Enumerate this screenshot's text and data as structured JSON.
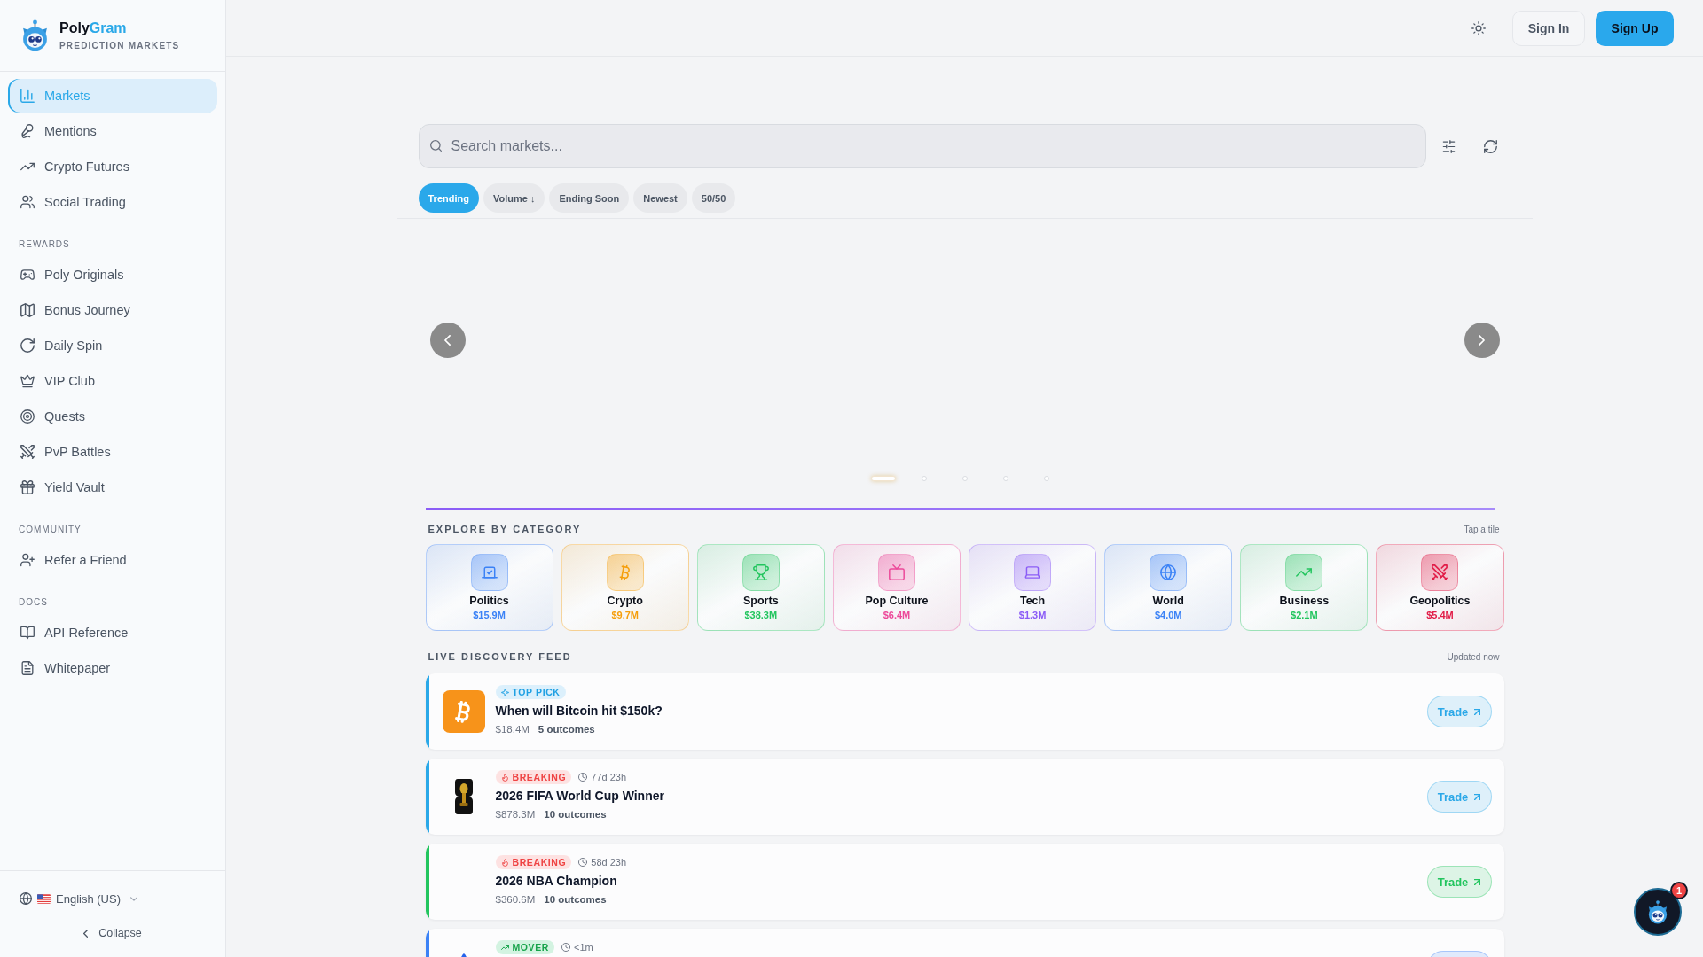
{
  "sidebar": {
    "brand": {
      "name_start": "Poly",
      "name_end": "Gram",
      "tagline": "PREDICTION MARKETS"
    },
    "sections": [
      {
        "items": [
          {
            "label": "Markets",
            "selected": true
          },
          {
            "label": "Mentions",
            "selected": false
          },
          {
            "label": "Crypto Futures",
            "selected": false
          },
          {
            "label": "Social Trading",
            "selected": false
          }
        ]
      },
      {
        "label": "REWARDS",
        "items": [
          {
            "label": "Poly Originals",
            "selected": false
          },
          {
            "label": "Bonus Journey",
            "selected": false
          },
          {
            "label": "Daily Spin",
            "selected": false
          },
          {
            "label": "VIP Club",
            "selected": false
          },
          {
            "label": "Quests",
            "selected": false
          },
          {
            "label": "PvP Battles",
            "selected": false
          },
          {
            "label": "Yield Vault",
            "selected": false
          }
        ]
      },
      {
        "label": "COMMUNITY",
        "items": [
          {
            "label": "Refer a Friend",
            "selected": false
          }
        ]
      },
      {
        "label": "DOCS",
        "items": [
          {
            "label": "API Reference",
            "selected": false
          },
          {
            "label": "Whitepaper",
            "selected": false
          }
        ]
      }
    ],
    "language": "English (US)",
    "collapse": "Collapse"
  },
  "header": {
    "sign_in": "Sign In",
    "sign_up": "Sign Up"
  },
  "search": {
    "placeholder": "Search markets..."
  },
  "sort_options": [
    {
      "label": "Trending",
      "selected": true
    },
    {
      "label": "Volume ↓",
      "selected": false
    },
    {
      "label": "Ending Soon",
      "selected": false
    },
    {
      "label": "Newest",
      "selected": false
    },
    {
      "label": "50/50",
      "selected": false
    }
  ],
  "carousel": {
    "dots": [
      {
        "selected": true
      },
      {
        "selected": false
      },
      {
        "selected": false
      },
      {
        "selected": false
      },
      {
        "selected": false
      }
    ]
  },
  "categories": {
    "title": "EXPLORE BY CATEGORY",
    "hint": "Tap a tile",
    "tiles": [
      {
        "name": "Politics",
        "volume": "$15.9M",
        "color": "#3b82f6"
      },
      {
        "name": "Crypto",
        "volume": "$9.7M",
        "color": "#f59e0b"
      },
      {
        "name": "Sports",
        "volume": "$38.3M",
        "color": "#22c55e"
      },
      {
        "name": "Pop Culture",
        "volume": "$6.4M",
        "color": "#ec4899"
      },
      {
        "name": "Tech",
        "volume": "$1.3M",
        "color": "#8b5cf6"
      },
      {
        "name": "World",
        "volume": "$4.0M",
        "color": "#3b82f6"
      },
      {
        "name": "Business",
        "volume": "$2.1M",
        "color": "#22c55e"
      },
      {
        "name": "Geopolitics",
        "volume": "$5.4M",
        "color": "#e11d48"
      }
    ]
  },
  "feed": {
    "title": "LIVE DISCOVERY FEED",
    "status": "Updated now",
    "cards": [
      {
        "color": "#2aa8e8",
        "badge": {
          "kind": "pick",
          "label": "TOP PICK"
        },
        "title": "When will Bitcoin hit $150k?",
        "volume": "$18.4M",
        "outcomes": "5 outcomes",
        "button": "Trade"
      },
      {
        "color": "#2aa8e8",
        "badge": {
          "kind": "breaking",
          "label": "BREAKING"
        },
        "time": "77d 23h",
        "title": "2026 FIFA World Cup Winner",
        "volume": "$878.3M",
        "outcomes": "10 outcomes",
        "button": "Trade"
      },
      {
        "color": "#22c55e",
        "badge": {
          "kind": "breaking",
          "label": "BREAKING"
        },
        "time": "58d 23h",
        "title": "2026 NBA Champion",
        "volume": "$360.6M",
        "outcomes": "10 outcomes",
        "button": "Trade"
      },
      {
        "color": "#3b82f6",
        "badge": {
          "kind": "mover",
          "label": "MOVER"
        },
        "time": "<1m"
      }
    ]
  },
  "chat_button": {
    "badge": "1"
  }
}
